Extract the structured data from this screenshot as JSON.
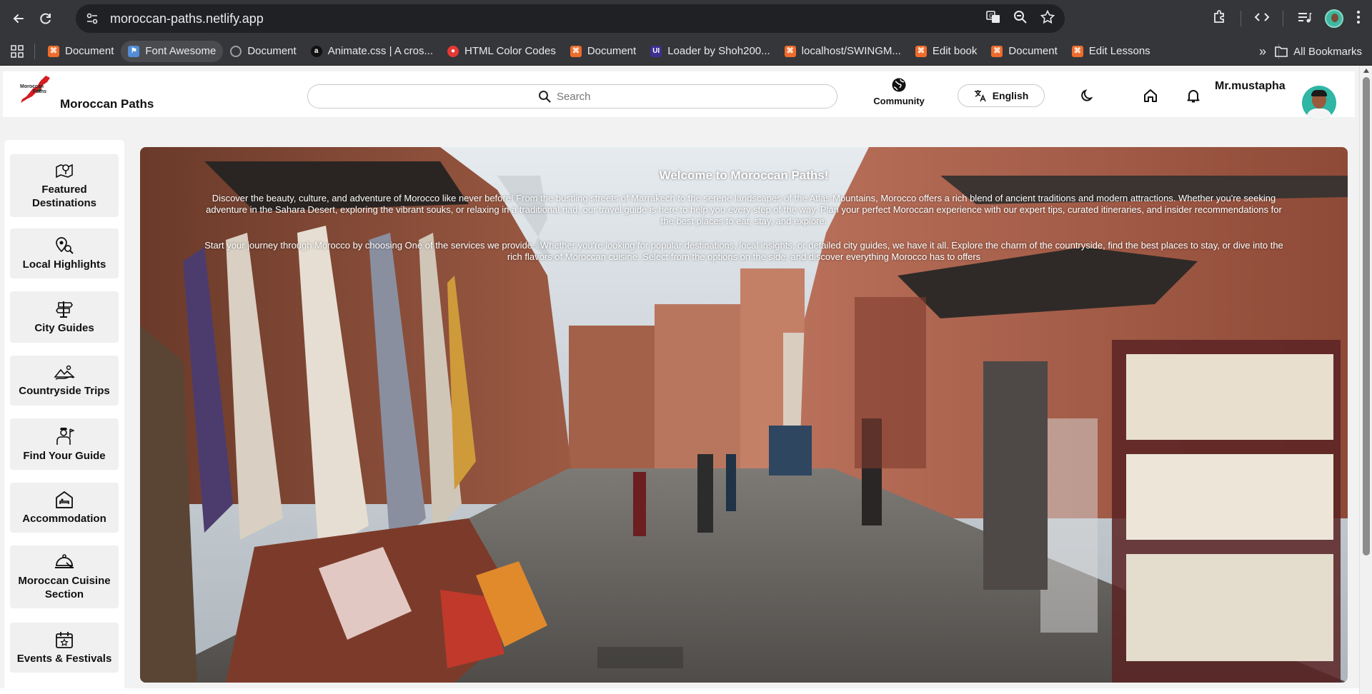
{
  "browser": {
    "url": "moroccan-paths.netlify.app",
    "bookmarks": [
      {
        "label": "Document",
        "icon": "codepen-icon"
      },
      {
        "label": "Font Awesome",
        "icon": "flag-icon"
      },
      {
        "label": "Document",
        "icon": "globe-icon"
      },
      {
        "label": "Animate.css | A cros...",
        "icon": "amazon-icon"
      },
      {
        "label": "HTML Color Codes",
        "icon": "color-icon"
      },
      {
        "label": "Document",
        "icon": "codepen-icon"
      },
      {
        "label": "Loader by Shoh200...",
        "icon": "uiverse-icon"
      },
      {
        "label": "localhost/SWINGM...",
        "icon": "codepen-icon"
      },
      {
        "label": "Edit book",
        "icon": "codepen-icon"
      },
      {
        "label": "Document",
        "icon": "codepen-icon"
      },
      {
        "label": "Edit Lessons",
        "icon": "codepen-icon"
      }
    ],
    "more_label": "»",
    "all_bookmarks_label": "All Bookmarks"
  },
  "header": {
    "logo_text_1": "Moroccan",
    "logo_text_2": "Paths",
    "site_name": "Moroccan Paths",
    "search_placeholder": "Search",
    "community_label": "Community",
    "language_label": "English",
    "username": "Mr.mustapha"
  },
  "sidebar": {
    "items": [
      {
        "label": "Featured Destinations",
        "icon": "map-pin-icon"
      },
      {
        "label": "Local Highlights",
        "icon": "search-location-icon"
      },
      {
        "label": "City Guides",
        "icon": "signpost-icon"
      },
      {
        "label": "Countryside Trips",
        "icon": "landscape-icon"
      },
      {
        "label": "Find Your Guide",
        "icon": "tour-guide-icon"
      },
      {
        "label": "Accommodation",
        "icon": "hotel-icon"
      },
      {
        "label": "Moroccan Cuisine Section",
        "icon": "cloche-icon"
      },
      {
        "label": "Events & Festivals",
        "icon": "calendar-star-icon"
      }
    ]
  },
  "hero": {
    "title": "Welcome to Moroccan Paths!",
    "paragraph_1": "Discover the beauty, culture, and adventure of Morocco like never before! From the bustling streets of Marrakech to the serene landscapes of the Atlas Mountains, Morocco offers a rich blend of ancient traditions and modern attractions. Whether you're seeking adventure in the Sahara Desert, exploring the vibrant souks, or relaxing in a traditional riad, our travel guide is here to help you every step of the way. Plan your perfect Moroccan experience with our expert tips, curated itineraries, and insider recommendations for the best places to eat, stay, and explore.",
    "paragraph_2": "Start your journey through Morocco by choosing One of the services we provide . Whether you're looking for popular destinations, local insights, or detailed city guides, we have it all. Explore the charm of the countryside, find the best places to stay, or dive into the rich flavors of Moroccan cuisine. Select from the options on the side. and discover everything Morocco has to offers"
  }
}
